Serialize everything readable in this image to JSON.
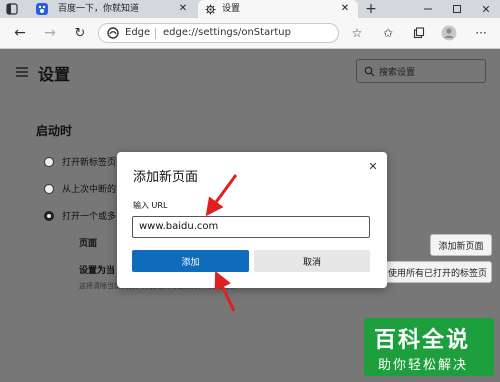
{
  "browser": {
    "tabs": [
      {
        "label": "百度一下，你就知道"
      },
      {
        "label": "设置"
      }
    ],
    "address": {
      "site": "Edge",
      "path": "edge://settings/onStartup"
    }
  },
  "settings": {
    "title": "设置",
    "search_placeholder": "搜索设置",
    "section_title": "启动时",
    "options": [
      {
        "label": "打开新标签页"
      },
      {
        "label": "从上次中断的"
      },
      {
        "label": "打开一个或多"
      }
    ],
    "pages_label": "页面",
    "set_current_label": "设置为当",
    "add_page_button": "添加新页面",
    "use_open_tabs_button": "使用所有已打开的标签页",
    "hint_text": "这将清除当前列表，并使用所有当前打开的标签页。"
  },
  "dialog": {
    "title": "添加新页面",
    "url_label": "输入 URL",
    "url_value": "www.baidu.com",
    "add_button": "添加",
    "cancel_button": "取消"
  },
  "watermark": {
    "title": "百科全说",
    "subtitle": "助你轻松解决"
  },
  "colors": {
    "primary": "#0f6cbd",
    "arrow": "#e02020",
    "watermark": "#1e9f3d"
  }
}
